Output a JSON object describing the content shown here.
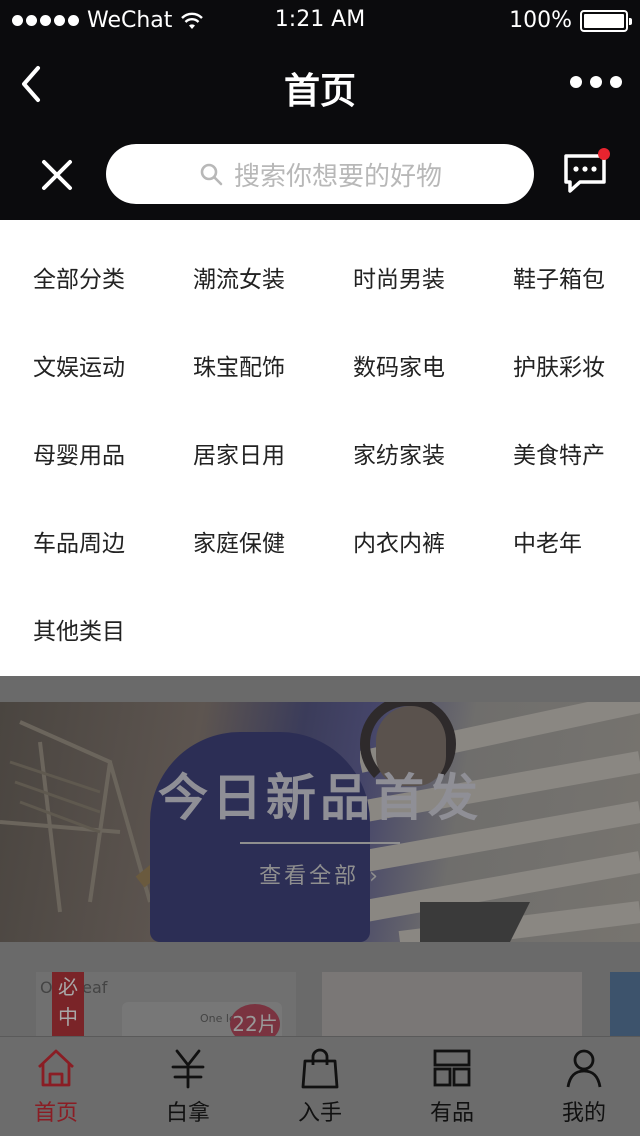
{
  "status_bar": {
    "carrier": "WeChat",
    "time": "1:21 AM",
    "battery": "100%"
  },
  "nav": {
    "title": "首页"
  },
  "search": {
    "placeholder": "搜索你想要的好物"
  },
  "categories": [
    "全部分类",
    "潮流女装",
    "时尚男装",
    "鞋子箱包",
    "文娱运动",
    "珠宝配饰",
    "数码家电",
    "护肤彩妆",
    "母婴用品",
    "居家日用",
    "家纺家装",
    "美食特产",
    "车品周边",
    "家庭保健",
    "内衣内裤",
    "中老年",
    "其他类目"
  ],
  "banner": {
    "headline": "今日新品首发",
    "link": "查看全部 ›"
  },
  "products": {
    "badge": "必中",
    "brand": "One leaf",
    "pack_label": "One leaf",
    "count": "22片"
  },
  "tabs": [
    {
      "label": "首页",
      "icon": "home-icon",
      "active": true
    },
    {
      "label": "白拿",
      "icon": "yen-icon",
      "active": false
    },
    {
      "label": "入手",
      "icon": "shopping-bag-icon",
      "active": false
    },
    {
      "label": "有品",
      "icon": "grid-icon",
      "active": false
    },
    {
      "label": "我的",
      "icon": "user-icon",
      "active": false
    }
  ],
  "colors": {
    "header_bg": "#0b0b0d",
    "accent_red": "#e8242f",
    "active_tab": "#8a1d24"
  }
}
